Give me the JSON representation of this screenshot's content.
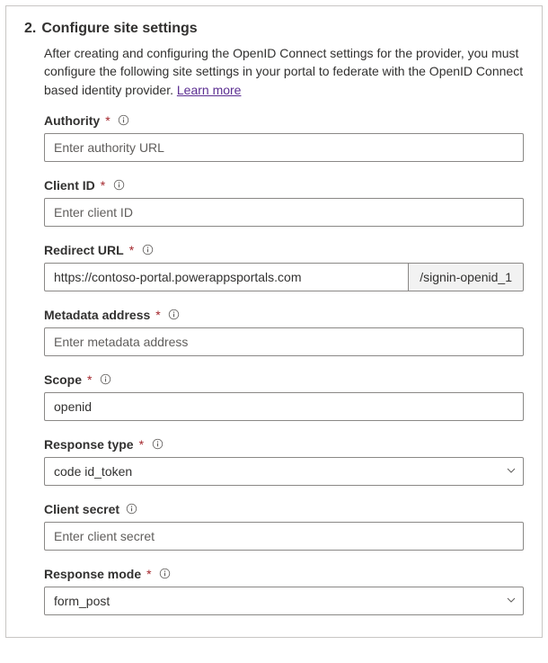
{
  "step": {
    "number": "2.",
    "title": "Configure site settings",
    "description": "After creating and configuring the OpenID Connect settings for the provider, you must configure the following site settings in your portal to federate with the OpenID Connect based identity provider.",
    "learn_more": "Learn more"
  },
  "fields": {
    "authority": {
      "label": "Authority",
      "required": "*",
      "placeholder": "Enter authority URL",
      "value": ""
    },
    "client_id": {
      "label": "Client ID",
      "required": "*",
      "placeholder": "Enter client ID",
      "value": ""
    },
    "redirect_url": {
      "label": "Redirect URL",
      "required": "*",
      "value": "https://contoso-portal.powerappsportals.com",
      "suffix": "/signin-openid_1"
    },
    "metadata": {
      "label": "Metadata address",
      "required": "*",
      "placeholder": "Enter metadata address",
      "value": ""
    },
    "scope": {
      "label": "Scope",
      "required": "*",
      "value": "openid"
    },
    "response_type": {
      "label": "Response type",
      "required": "*",
      "value": "code id_token"
    },
    "client_secret": {
      "label": "Client secret",
      "required": "",
      "placeholder": "Enter client secret",
      "value": ""
    },
    "response_mode": {
      "label": "Response mode",
      "required": "*",
      "value": "form_post"
    }
  }
}
